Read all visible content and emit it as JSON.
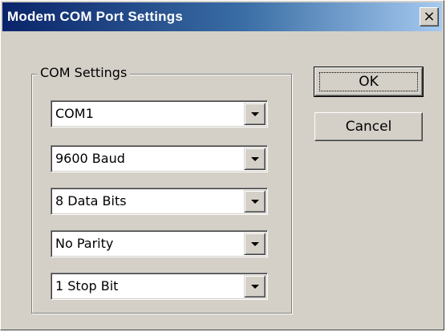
{
  "window": {
    "title": "Modem COM Port Settings",
    "close_symbol": "×"
  },
  "group": {
    "label": "COM Settings"
  },
  "selects": [
    {
      "id": "port",
      "value": "COM1"
    },
    {
      "id": "baud",
      "value": "9600 Baud"
    },
    {
      "id": "data_bits",
      "value": "8 Data Bits"
    },
    {
      "id": "parity",
      "value": "No Parity"
    },
    {
      "id": "stop_bits",
      "value": "1 Stop Bit"
    }
  ],
  "buttons": {
    "ok_label": "OK",
    "cancel_label": "Cancel"
  },
  "colors": {
    "title_gradient_start": "#0a246a",
    "title_gradient_end": "#a6caf0",
    "dialog_face": "#d4d0c8"
  },
  "icons": {
    "close": "close-icon",
    "dropdown": "chevron-down-icon"
  }
}
